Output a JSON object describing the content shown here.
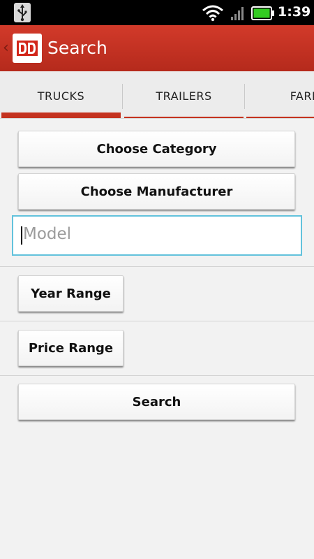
{
  "status_bar": {
    "time": "1:39",
    "icons": [
      "usb-icon",
      "wifi-icon",
      "signal-icon",
      "battery-icon"
    ],
    "battery_color": "#33cc22"
  },
  "action_bar": {
    "title": "Search",
    "logo_text": "DD",
    "background_color": "#c4321f"
  },
  "tabs": [
    {
      "label": "TRUCKS",
      "selected": true
    },
    {
      "label": "TRAILERS",
      "selected": false
    },
    {
      "label": "FARM",
      "selected": false
    }
  ],
  "form": {
    "category_label": "Choose Category",
    "manufacturer_label": "Choose Manufacturer",
    "model_placeholder": "Model",
    "model_value": "",
    "year_range_label": "Year Range",
    "price_range_label": "Price Range",
    "search_label": "Search"
  },
  "colors": {
    "accent": "#c4321f",
    "focus_border": "#62c2dc"
  }
}
